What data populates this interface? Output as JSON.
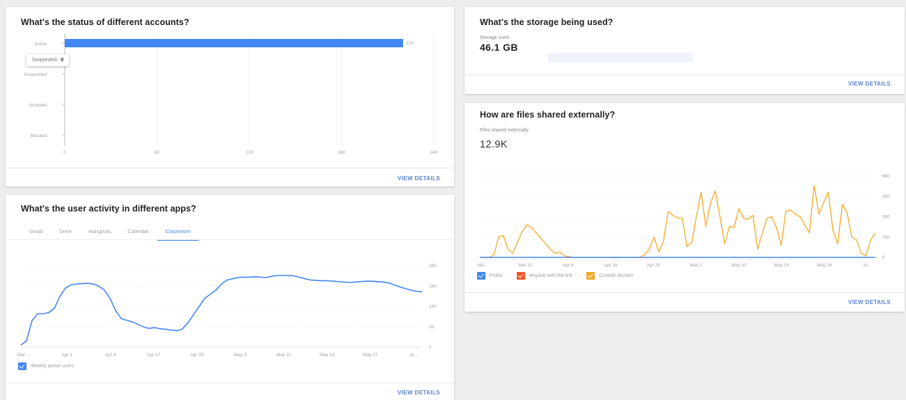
{
  "accounts_card": {
    "title": "What's the status of different accounts?",
    "tooltip_label": "Suspended :",
    "tooltip_value": "0",
    "view_details": "VIEW DETAILS"
  },
  "storage_card": {
    "title": "What's the storage being used?",
    "label": "Storage used",
    "value": "46.1 GB",
    "view_details": "VIEW DETAILS"
  },
  "activity_card": {
    "title": "What's the user activity in different apps?",
    "tabs": [
      "Gmail",
      "Drive",
      "Hangouts",
      "Calendar",
      "Classroom"
    ],
    "active_tab": "Classroom",
    "legend": "Weekly active users",
    "view_details": "VIEW DETAILS"
  },
  "sharing_card": {
    "title": "How are files shared externally?",
    "label": "Files shared externally",
    "value": "12.9K",
    "legend": [
      "Public",
      "Anyone with the link",
      "Outside domain"
    ],
    "view_details": "VIEW DETAILS"
  },
  "colors": {
    "blue": "#4285f4",
    "orange": "#f5a623",
    "red_orange": "#f4511e"
  },
  "chart_data": [
    {
      "type": "bar",
      "orientation": "horizontal",
      "categories": [
        "Active",
        "Suspended",
        "Archived",
        "Blocked"
      ],
      "values": [
        220,
        0,
        0,
        0
      ],
      "xticks": [
        "0",
        "60",
        "120",
        "180",
        "240"
      ],
      "xlim": [
        0,
        240
      ],
      "data_label": "220",
      "color": "#4285f4"
    },
    {
      "type": "line",
      "x": [
        "Mar ...",
        "Apr 1",
        "Apr 9",
        "Apr 17",
        "Apr 25",
        "May 3",
        "May 11",
        "May 19",
        "May 27",
        "Ju..."
      ],
      "yticks": [
        "0",
        "50",
        "100",
        "150",
        "200"
      ],
      "ylim": [
        0,
        200
      ],
      "series": [
        {
          "name": "Weekly active users",
          "color": "#4285f4",
          "values": [
            5,
            15,
            65,
            82,
            82,
            85,
            95,
            125,
            145,
            153,
            155,
            156,
            157,
            155,
            150,
            140,
            120,
            90,
            70,
            66,
            62,
            56,
            50,
            46,
            48,
            45,
            44,
            42,
            40,
            45,
            60,
            80,
            100,
            120,
            130,
            140,
            155,
            165,
            168,
            171,
            172,
            172,
            173,
            172,
            171,
            174,
            176,
            176,
            176,
            175,
            172,
            168,
            165,
            164,
            163,
            163,
            162,
            161,
            160,
            159,
            160,
            161,
            162,
            162,
            161,
            160,
            158,
            153,
            148,
            144,
            140,
            137,
            136
          ]
        }
      ]
    },
    {
      "type": "line",
      "x": [
        "Ma...",
        "Mar 31",
        "Apr 8",
        "Apr 16",
        "Apr 24",
        "May 2",
        "May 10",
        "May 18",
        "May 26",
        "Ju..."
      ],
      "yticks": [
        "0",
        "150",
        "300",
        "450",
        "600"
      ],
      "ylim": [
        0,
        600
      ],
      "series": [
        {
          "name": "Outside domain",
          "color": "#f5a623",
          "values": [
            0,
            0,
            0,
            20,
            150,
            160,
            60,
            30,
            110,
            190,
            240,
            220,
            180,
            140,
            100,
            60,
            30,
            40,
            10,
            5,
            0,
            0,
            0,
            0,
            0,
            0,
            0,
            0,
            0,
            0,
            0,
            0,
            0,
            0,
            0,
            20,
            60,
            150,
            40,
            120,
            340,
            310,
            290,
            290,
            80,
            110,
            300,
            480,
            230,
            400,
            490,
            300,
            100,
            230,
            220,
            360,
            290,
            280,
            310,
            60,
            180,
            290,
            300,
            220,
            90,
            340,
            350,
            320,
            300,
            240,
            180,
            530,
            320,
            400,
            480,
            200,
            100,
            390,
            330,
            150,
            130,
            30,
            10,
            130,
            180
          ]
        }
      ]
    }
  ]
}
